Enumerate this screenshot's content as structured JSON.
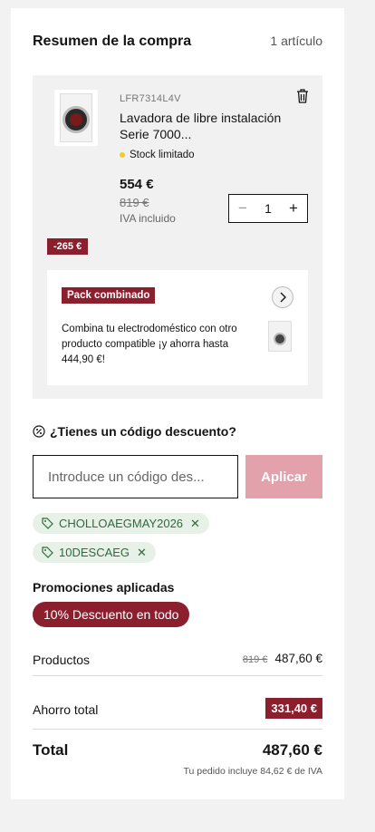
{
  "summary": {
    "title": "Resumen de la compra",
    "item_count": "1 artículo"
  },
  "item": {
    "sku": "LFR7314L4V",
    "name": "Lavadora de libre instalación Serie 7000...",
    "stock": "Stock limitado",
    "price": "554 €",
    "old_price": "819 €",
    "iva_note": "IVA incluido",
    "quantity": "1",
    "discount": "-265 €"
  },
  "pack": {
    "tag": "Pack combinado",
    "text": "Combina tu electrodoméstico con otro producto compatible ¡y ahorra hasta 444,90 €!"
  },
  "coupon": {
    "title": "¿Tienes un código descuento?",
    "placeholder": "Introduce un código des...",
    "apply": "Aplicar",
    "applied": [
      "CHOLLOAEGMAY2026",
      "10DESCAEG"
    ]
  },
  "promotions": {
    "title": "Promociones aplicadas",
    "items": [
      "10% Descuento en todo"
    ]
  },
  "totals": {
    "products_label": "Productos",
    "products_old": "819 €",
    "products_value": "487,60 €",
    "saving_label": "Ahorro total",
    "saving_value": "331,40 €",
    "total_label": "Total",
    "total_value": "487,60 €",
    "tax_note": "Tu pedido incluye 84,62 € de IVA"
  },
  "colors": {
    "brand": "#8b1f2e",
    "apply_disabled": "#e3a1ab",
    "chip_bg": "#e8f1e8",
    "chip_text": "#2e6b3a",
    "stock_dot": "#f4cb2a"
  },
  "icons": [
    "trash-icon",
    "chevron-right-icon",
    "percent-icon",
    "tag-icon",
    "close-icon",
    "minus-icon",
    "plus-icon"
  ]
}
